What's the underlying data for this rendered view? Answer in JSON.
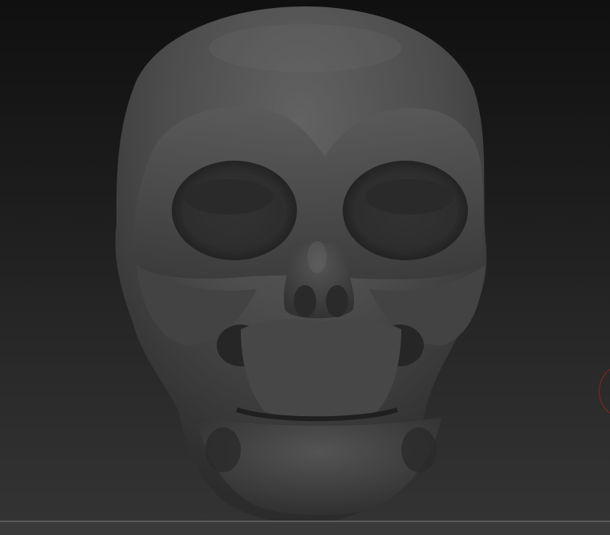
{
  "viewport": {
    "background_top": "#101010",
    "background_bottom": "#343434"
  },
  "model": {
    "subject": "skull-sculpt",
    "material_base": "#4a4a4a",
    "material_highlight": "#6a6a6a",
    "material_shadow": "#1e1e1e"
  },
  "cursor": {
    "icon": "brush-cursor-icon",
    "color": "#8b2222"
  }
}
